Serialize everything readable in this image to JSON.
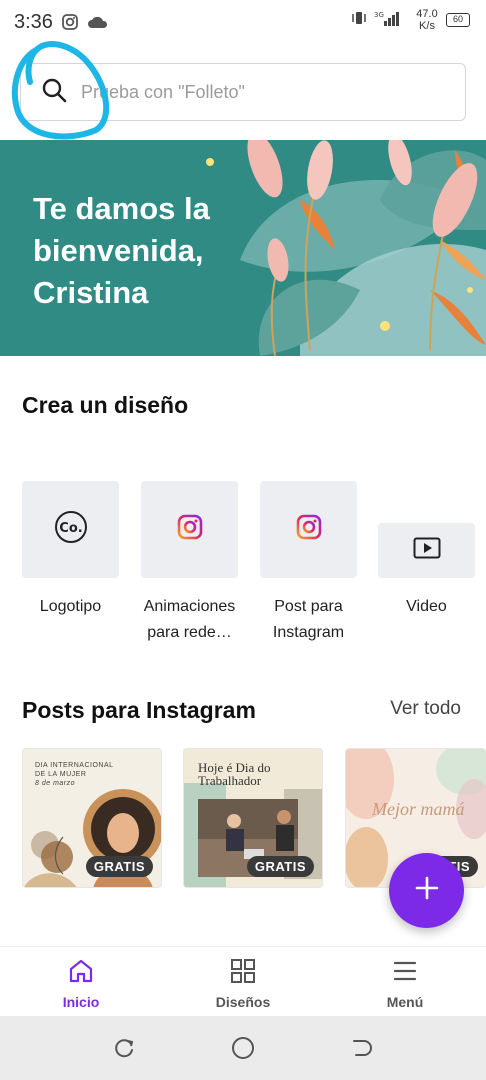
{
  "status_bar": {
    "time": "3:36",
    "net_speed_value": "47.0",
    "net_speed_unit": "K/s",
    "battery": "60"
  },
  "search": {
    "placeholder": "Prueba con \"Folleto\""
  },
  "banner": {
    "greeting": "Te damos la bienvenida, Cristina"
  },
  "create_section": {
    "title": "Crea un diseño",
    "items": [
      {
        "label": "Logotipo",
        "icon": "logo-co-icon"
      },
      {
        "label": "Animaciones para rede…",
        "icon": "instagram-icon"
      },
      {
        "label": "Post para Instagram",
        "icon": "instagram-icon"
      },
      {
        "label": "Video",
        "icon": "video-play-icon"
      }
    ]
  },
  "posts_section": {
    "title": "Posts para Instagram",
    "see_all": "Ver todo",
    "templates": [
      {
        "badge": "GRATIS",
        "line1": "DIA INTERNACIONAL",
        "line2": "DE LA MUJER",
        "line3": "8 de marzo"
      },
      {
        "badge": "GRATIS",
        "line1": "Hoje é Dia do",
        "line2": "Trabalhador"
      },
      {
        "badge": "GRATIS",
        "line1": "Mejor mamá"
      }
    ]
  },
  "fab": {
    "icon": "plus-icon"
  },
  "bottom_nav": {
    "items": [
      {
        "label": "Inicio",
        "icon": "home-icon",
        "active": true
      },
      {
        "label": "Diseños",
        "icon": "grid-icon",
        "active": false
      },
      {
        "label": "Menú",
        "icon": "menu-icon",
        "active": false
      }
    ]
  },
  "colors": {
    "accent": "#7d2ae8",
    "banner_bg": "#2f8b83",
    "annotation": "#1eb6e6"
  }
}
